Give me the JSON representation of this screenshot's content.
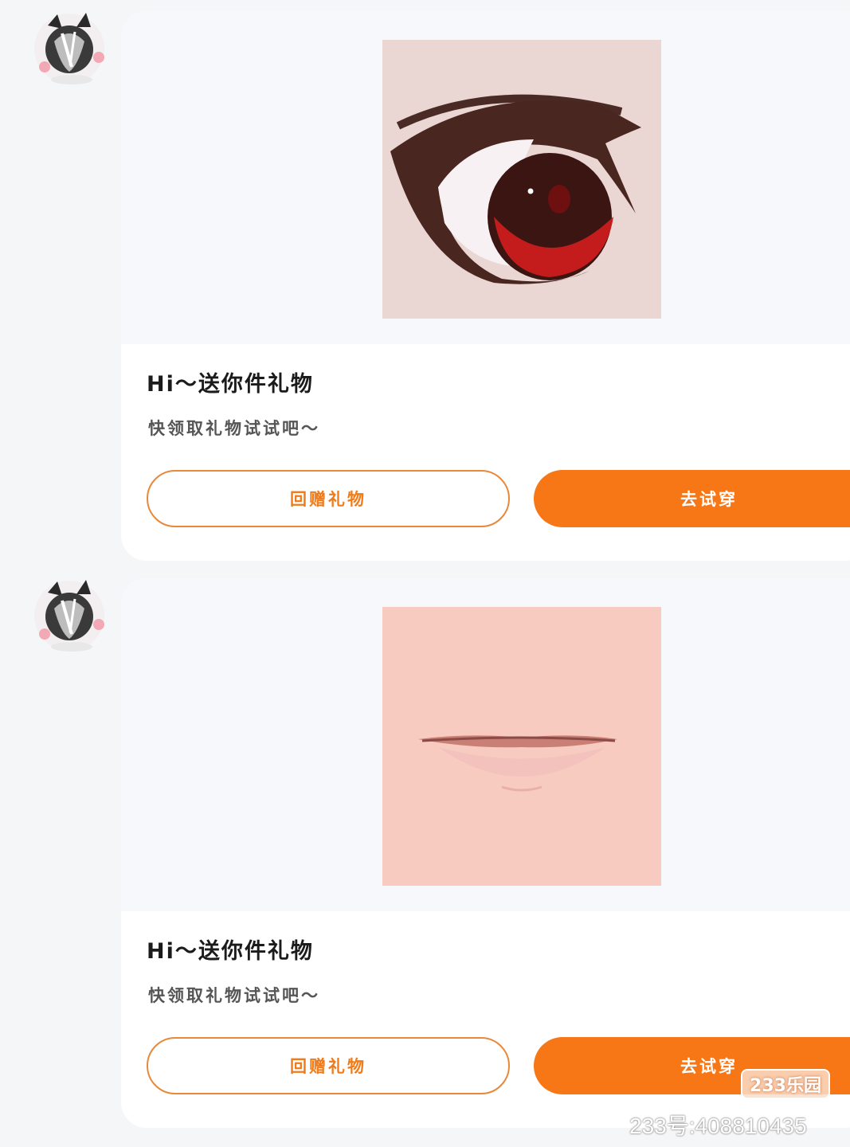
{
  "messages": [
    {
      "gift_image": "eye-gift-image",
      "title": "Hi～送你件礼物",
      "subtitle": "快领取礼物试试吧～",
      "return_button": "回赠礼物",
      "try_button": "去试穿"
    },
    {
      "gift_image": "mouth-gift-image",
      "title": "Hi～送你件礼物",
      "subtitle": "快领取礼物试试吧～",
      "return_button": "回赠礼物",
      "try_button": "去试穿"
    }
  ],
  "watermark": {
    "badge": "233乐园",
    "id_text": "233号:408810435"
  },
  "colors": {
    "accent": "#f77716",
    "card_bg": "#ffffff",
    "page_bg": "#f5f6f8"
  }
}
